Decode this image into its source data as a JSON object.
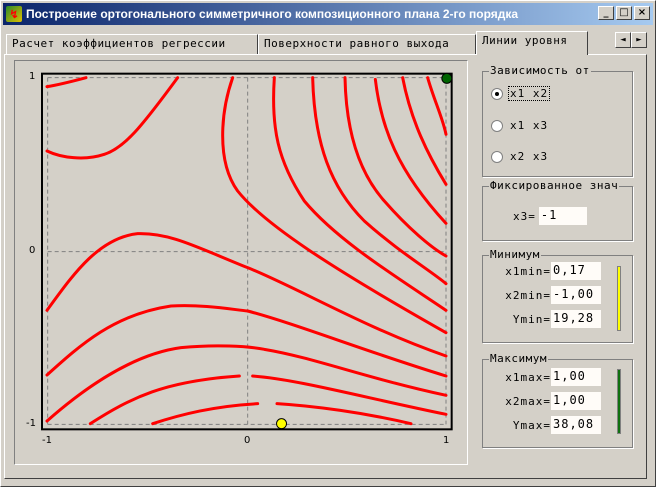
{
  "window": {
    "title": "Построение ортогонального симметричного композиционного плана 2-го порядка",
    "minimize": "_",
    "maximize": "□",
    "close": "×"
  },
  "tabs": [
    {
      "label": "Расчет коэффициентов регрессии"
    },
    {
      "label": "Поверхности равного выхода"
    },
    {
      "label": "Линии уровня"
    }
  ],
  "tab_scroll": {
    "left": "◄",
    "right": "►"
  },
  "plot": {
    "x_ticks": [
      "-1",
      "0",
      "1"
    ],
    "y_ticks": [
      "1",
      "0",
      "-1"
    ],
    "line_color": "#ff0000",
    "min_point_color": "#ffff00",
    "max_point_color": "#006400",
    "min_point": {
      "x1": 0.17,
      "x2": -1.0
    },
    "max_point": {
      "x1": 1.0,
      "x2": 1.0
    }
  },
  "dependency": {
    "title": "Зависимость от",
    "options": [
      {
        "label": "x1 x2",
        "selected": true
      },
      {
        "label": "x1 x3",
        "selected": false
      },
      {
        "label": "x2 x3",
        "selected": false
      }
    ]
  },
  "fixed": {
    "title": "Фиксированное знач",
    "label": "x3=",
    "value": "-1"
  },
  "minimum": {
    "title": "Минимум",
    "rows": [
      {
        "label": "x1min=",
        "value": "0,17"
      },
      {
        "label": "x2min=",
        "value": "-1,00"
      },
      {
        "label": "Ymin=",
        "value": "19,28"
      }
    ],
    "color": "#ffff00"
  },
  "maximum": {
    "title": "Максимум",
    "rows": [
      {
        "label": "x1max=",
        "value": "1,00"
      },
      {
        "label": "x2max=",
        "value": "1,00"
      },
      {
        "label": "Ymax=",
        "value": "38,08"
      }
    ],
    "color": "#107010"
  }
}
